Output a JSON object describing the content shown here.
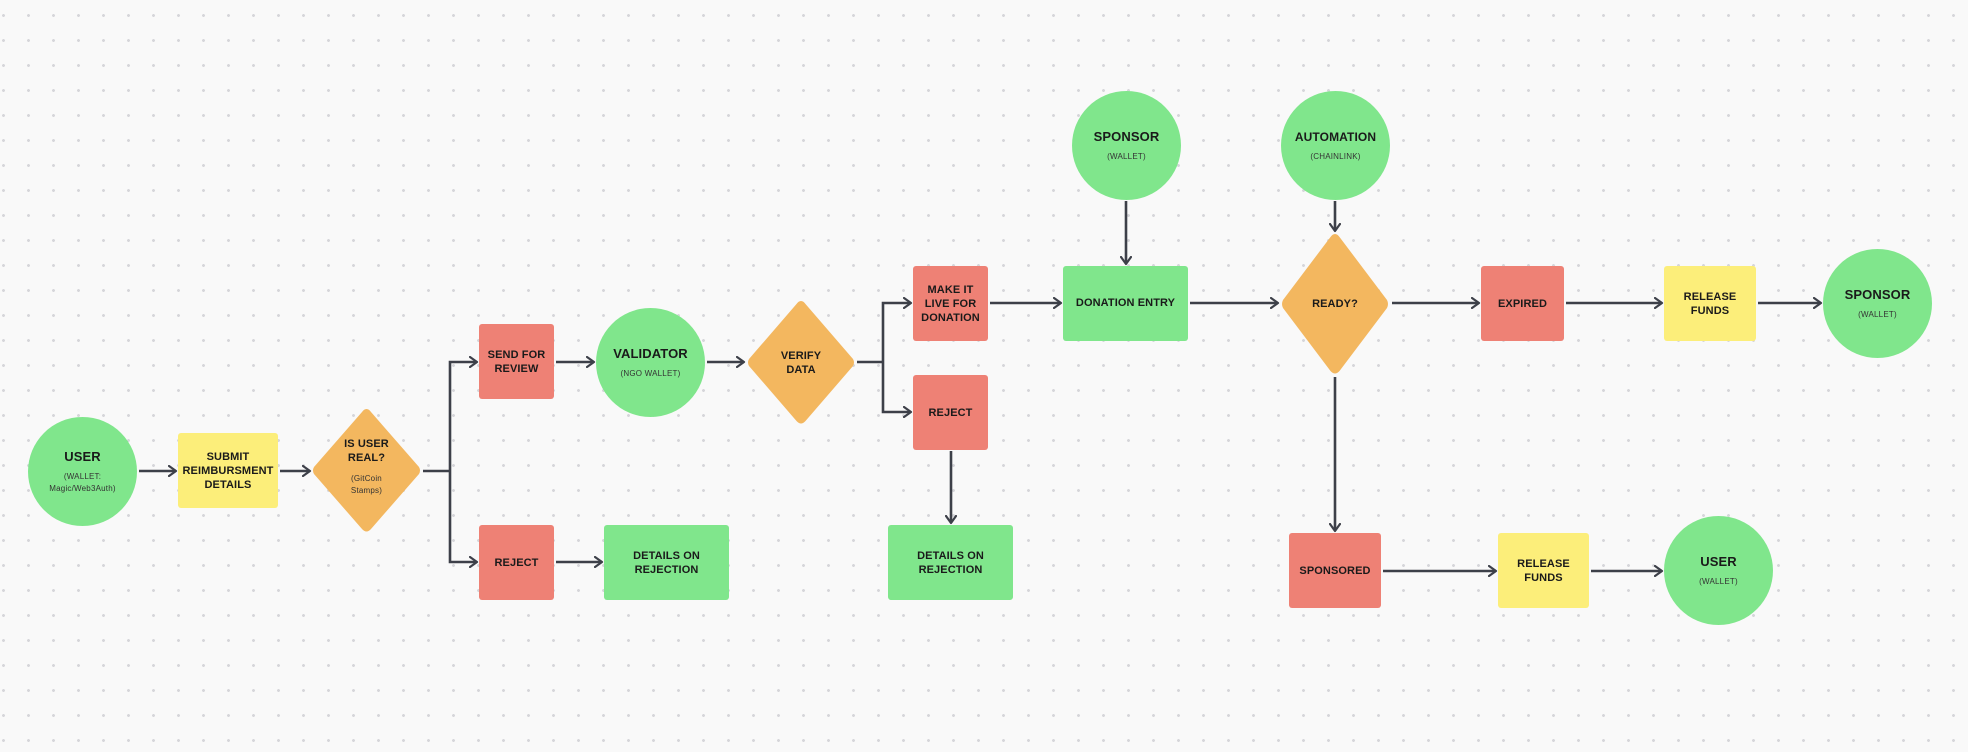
{
  "diagram": {
    "type": "flowchart",
    "colors": {
      "background": "#f9f9f9",
      "grid_dot": "#d6d6da",
      "actor": "#80e68c",
      "action": "#ee8175",
      "funds": "#fcee7a",
      "decision": "#f3b75f",
      "connector": "#3d4049"
    },
    "nodes": {
      "user_start": {
        "title": "USER",
        "subtitle": "(WALLET:\nMagic/Web3Auth)"
      },
      "submit": {
        "title": "SUBMIT\nREIMBURSMENT\nDETAILS"
      },
      "is_user_real": {
        "title": "IS USER\nREAL?",
        "subtitle": "(GitCoin\nStamps)"
      },
      "send_for_review": {
        "title": "SEND FOR\nREVIEW"
      },
      "reject_1": {
        "title": "REJECT"
      },
      "details_rejection_1": {
        "title": "DETAILS ON\nREJECTION"
      },
      "validator": {
        "title": "VALIDATOR",
        "subtitle": "(NGO WALLET)"
      },
      "verify_data": {
        "title": "VERIFY\nDATA"
      },
      "make_live": {
        "title": "MAKE IT\nLIVE FOR\nDONATION"
      },
      "reject_2": {
        "title": "REJECT"
      },
      "details_rejection_2": {
        "title": "DETAILS ON\nREJECTION"
      },
      "sponsor_top": {
        "title": "SPONSOR",
        "subtitle": "(WALLET)"
      },
      "donation_entry": {
        "title": "DONATION ENTRY"
      },
      "automation": {
        "title": "AUTOMATION",
        "subtitle": "(CHAINLINK)"
      },
      "ready": {
        "title": "READY?"
      },
      "expired": {
        "title": "EXPIRED"
      },
      "release_funds_1": {
        "title": "RELEASE\nFUNDS"
      },
      "sponsor_end": {
        "title": "SPONSOR",
        "subtitle": "(WALLET)"
      },
      "sponsored": {
        "title": "SPONSORED"
      },
      "release_funds_2": {
        "title": "RELEASE\nFUNDS"
      },
      "user_end": {
        "title": "USER",
        "subtitle": "(WALLET)"
      }
    },
    "edges": [
      {
        "from": "user_start",
        "to": "submit"
      },
      {
        "from": "submit",
        "to": "is_user_real"
      },
      {
        "from": "is_user_real",
        "to": "send_for_review"
      },
      {
        "from": "is_user_real",
        "to": "reject_1"
      },
      {
        "from": "reject_1",
        "to": "details_rejection_1"
      },
      {
        "from": "send_for_review",
        "to": "validator"
      },
      {
        "from": "validator",
        "to": "verify_data"
      },
      {
        "from": "verify_data",
        "to": "make_live"
      },
      {
        "from": "verify_data",
        "to": "reject_2"
      },
      {
        "from": "reject_2",
        "to": "details_rejection_2"
      },
      {
        "from": "make_live",
        "to": "donation_entry"
      },
      {
        "from": "sponsor_top",
        "to": "donation_entry"
      },
      {
        "from": "donation_entry",
        "to": "ready"
      },
      {
        "from": "automation",
        "to": "ready"
      },
      {
        "from": "ready",
        "to": "expired"
      },
      {
        "from": "expired",
        "to": "release_funds_1"
      },
      {
        "from": "release_funds_1",
        "to": "sponsor_end"
      },
      {
        "from": "ready",
        "to": "sponsored"
      },
      {
        "from": "sponsored",
        "to": "release_funds_2"
      },
      {
        "from": "release_funds_2",
        "to": "user_end"
      }
    ]
  }
}
